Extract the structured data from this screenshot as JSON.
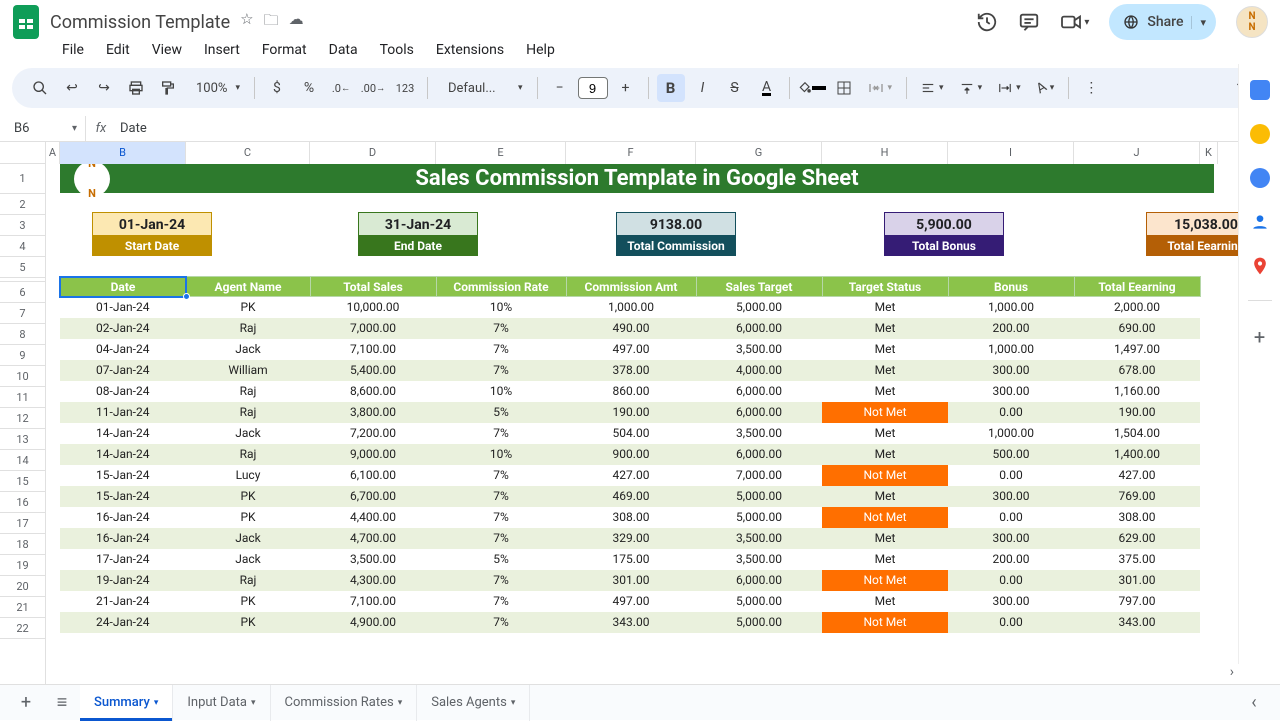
{
  "doc": {
    "name": "Commission Template"
  },
  "menu": [
    "File",
    "Edit",
    "View",
    "Insert",
    "Format",
    "Data",
    "Tools",
    "Extensions",
    "Help"
  ],
  "toolbar": {
    "zoom": "100%",
    "font": "Defaul...",
    "size": "9"
  },
  "share": {
    "label": "Share"
  },
  "cellref": "B6",
  "formula": "Date",
  "cols": [
    "A",
    "B",
    "C",
    "D",
    "E",
    "F",
    "G",
    "H",
    "I",
    "J",
    "K"
  ],
  "banner": "Sales Commission Template in Google Sheet",
  "cards": {
    "start": {
      "val": "01-Jan-24",
      "lbl": "Start Date"
    },
    "end": {
      "val": "31-Jan-24",
      "lbl": "End Date"
    },
    "comm": {
      "val": "9138.00",
      "lbl": "Total Commission"
    },
    "bonus": {
      "val": "5,900.00",
      "lbl": "Total Bonus"
    },
    "earn": {
      "val": "15,038.00",
      "lbl": "Total Eearning"
    }
  },
  "headers": [
    "Date",
    "Agent Name",
    "Total Sales",
    "Commission Rate",
    "Commission Amt",
    "Sales Target",
    "Target Status",
    "Bonus",
    "Total Eearning"
  ],
  "rows": [
    {
      "d": "01-Jan-24",
      "a": "PK",
      "s": "10,000.00",
      "r": "10%",
      "c": "1,000.00",
      "t": "5,000.00",
      "st": "Met",
      "b": "1,000.00",
      "e": "2,000.00"
    },
    {
      "d": "02-Jan-24",
      "a": "Raj",
      "s": "7,000.00",
      "r": "7%",
      "c": "490.00",
      "t": "6,000.00",
      "st": "Met",
      "b": "200.00",
      "e": "690.00"
    },
    {
      "d": "04-Jan-24",
      "a": "Jack",
      "s": "7,100.00",
      "r": "7%",
      "c": "497.00",
      "t": "3,500.00",
      "st": "Met",
      "b": "1,000.00",
      "e": "1,497.00"
    },
    {
      "d": "07-Jan-24",
      "a": "William",
      "s": "5,400.00",
      "r": "7%",
      "c": "378.00",
      "t": "4,000.00",
      "st": "Met",
      "b": "300.00",
      "e": "678.00"
    },
    {
      "d": "08-Jan-24",
      "a": "Raj",
      "s": "8,600.00",
      "r": "10%",
      "c": "860.00",
      "t": "6,000.00",
      "st": "Met",
      "b": "300.00",
      "e": "1,160.00"
    },
    {
      "d": "11-Jan-24",
      "a": "Raj",
      "s": "3,800.00",
      "r": "5%",
      "c": "190.00",
      "t": "6,000.00",
      "st": "Not Met",
      "b": "0.00",
      "e": "190.00"
    },
    {
      "d": "14-Jan-24",
      "a": "Jack",
      "s": "7,200.00",
      "r": "7%",
      "c": "504.00",
      "t": "3,500.00",
      "st": "Met",
      "b": "1,000.00",
      "e": "1,504.00"
    },
    {
      "d": "14-Jan-24",
      "a": "Raj",
      "s": "9,000.00",
      "r": "10%",
      "c": "900.00",
      "t": "6,000.00",
      "st": "Met",
      "b": "500.00",
      "e": "1,400.00"
    },
    {
      "d": "15-Jan-24",
      "a": "Lucy",
      "s": "6,100.00",
      "r": "7%",
      "c": "427.00",
      "t": "7,000.00",
      "st": "Not Met",
      "b": "0.00",
      "e": "427.00"
    },
    {
      "d": "15-Jan-24",
      "a": "PK",
      "s": "6,700.00",
      "r": "7%",
      "c": "469.00",
      "t": "5,000.00",
      "st": "Met",
      "b": "300.00",
      "e": "769.00"
    },
    {
      "d": "16-Jan-24",
      "a": "PK",
      "s": "4,400.00",
      "r": "7%",
      "c": "308.00",
      "t": "5,000.00",
      "st": "Not Met",
      "b": "0.00",
      "e": "308.00"
    },
    {
      "d": "16-Jan-24",
      "a": "Jack",
      "s": "4,700.00",
      "r": "7%",
      "c": "329.00",
      "t": "3,500.00",
      "st": "Met",
      "b": "300.00",
      "e": "629.00"
    },
    {
      "d": "17-Jan-24",
      "a": "Jack",
      "s": "3,500.00",
      "r": "5%",
      "c": "175.00",
      "t": "3,500.00",
      "st": "Met",
      "b": "200.00",
      "e": "375.00"
    },
    {
      "d": "19-Jan-24",
      "a": "Raj",
      "s": "4,300.00",
      "r": "7%",
      "c": "301.00",
      "t": "6,000.00",
      "st": "Not Met",
      "b": "0.00",
      "e": "301.00"
    },
    {
      "d": "21-Jan-24",
      "a": "PK",
      "s": "7,100.00",
      "r": "7%",
      "c": "497.00",
      "t": "5,000.00",
      "st": "Met",
      "b": "300.00",
      "e": "797.00"
    },
    {
      "d": "24-Jan-24",
      "a": "PK",
      "s": "4,900.00",
      "r": "7%",
      "c": "343.00",
      "t": "5,000.00",
      "st": "Not Met",
      "b": "0.00",
      "e": "343.00"
    }
  ],
  "tabs": [
    "Summary",
    "Input Data",
    "Commission Rates",
    "Sales Agents"
  ],
  "rownums_tall": [
    1
  ],
  "rownums_card": [
    2,
    3,
    4,
    5
  ],
  "rownums_data": [
    6,
    7,
    8,
    9,
    10,
    11,
    12,
    13,
    14,
    15,
    16,
    17,
    18,
    19,
    20,
    21,
    22
  ]
}
